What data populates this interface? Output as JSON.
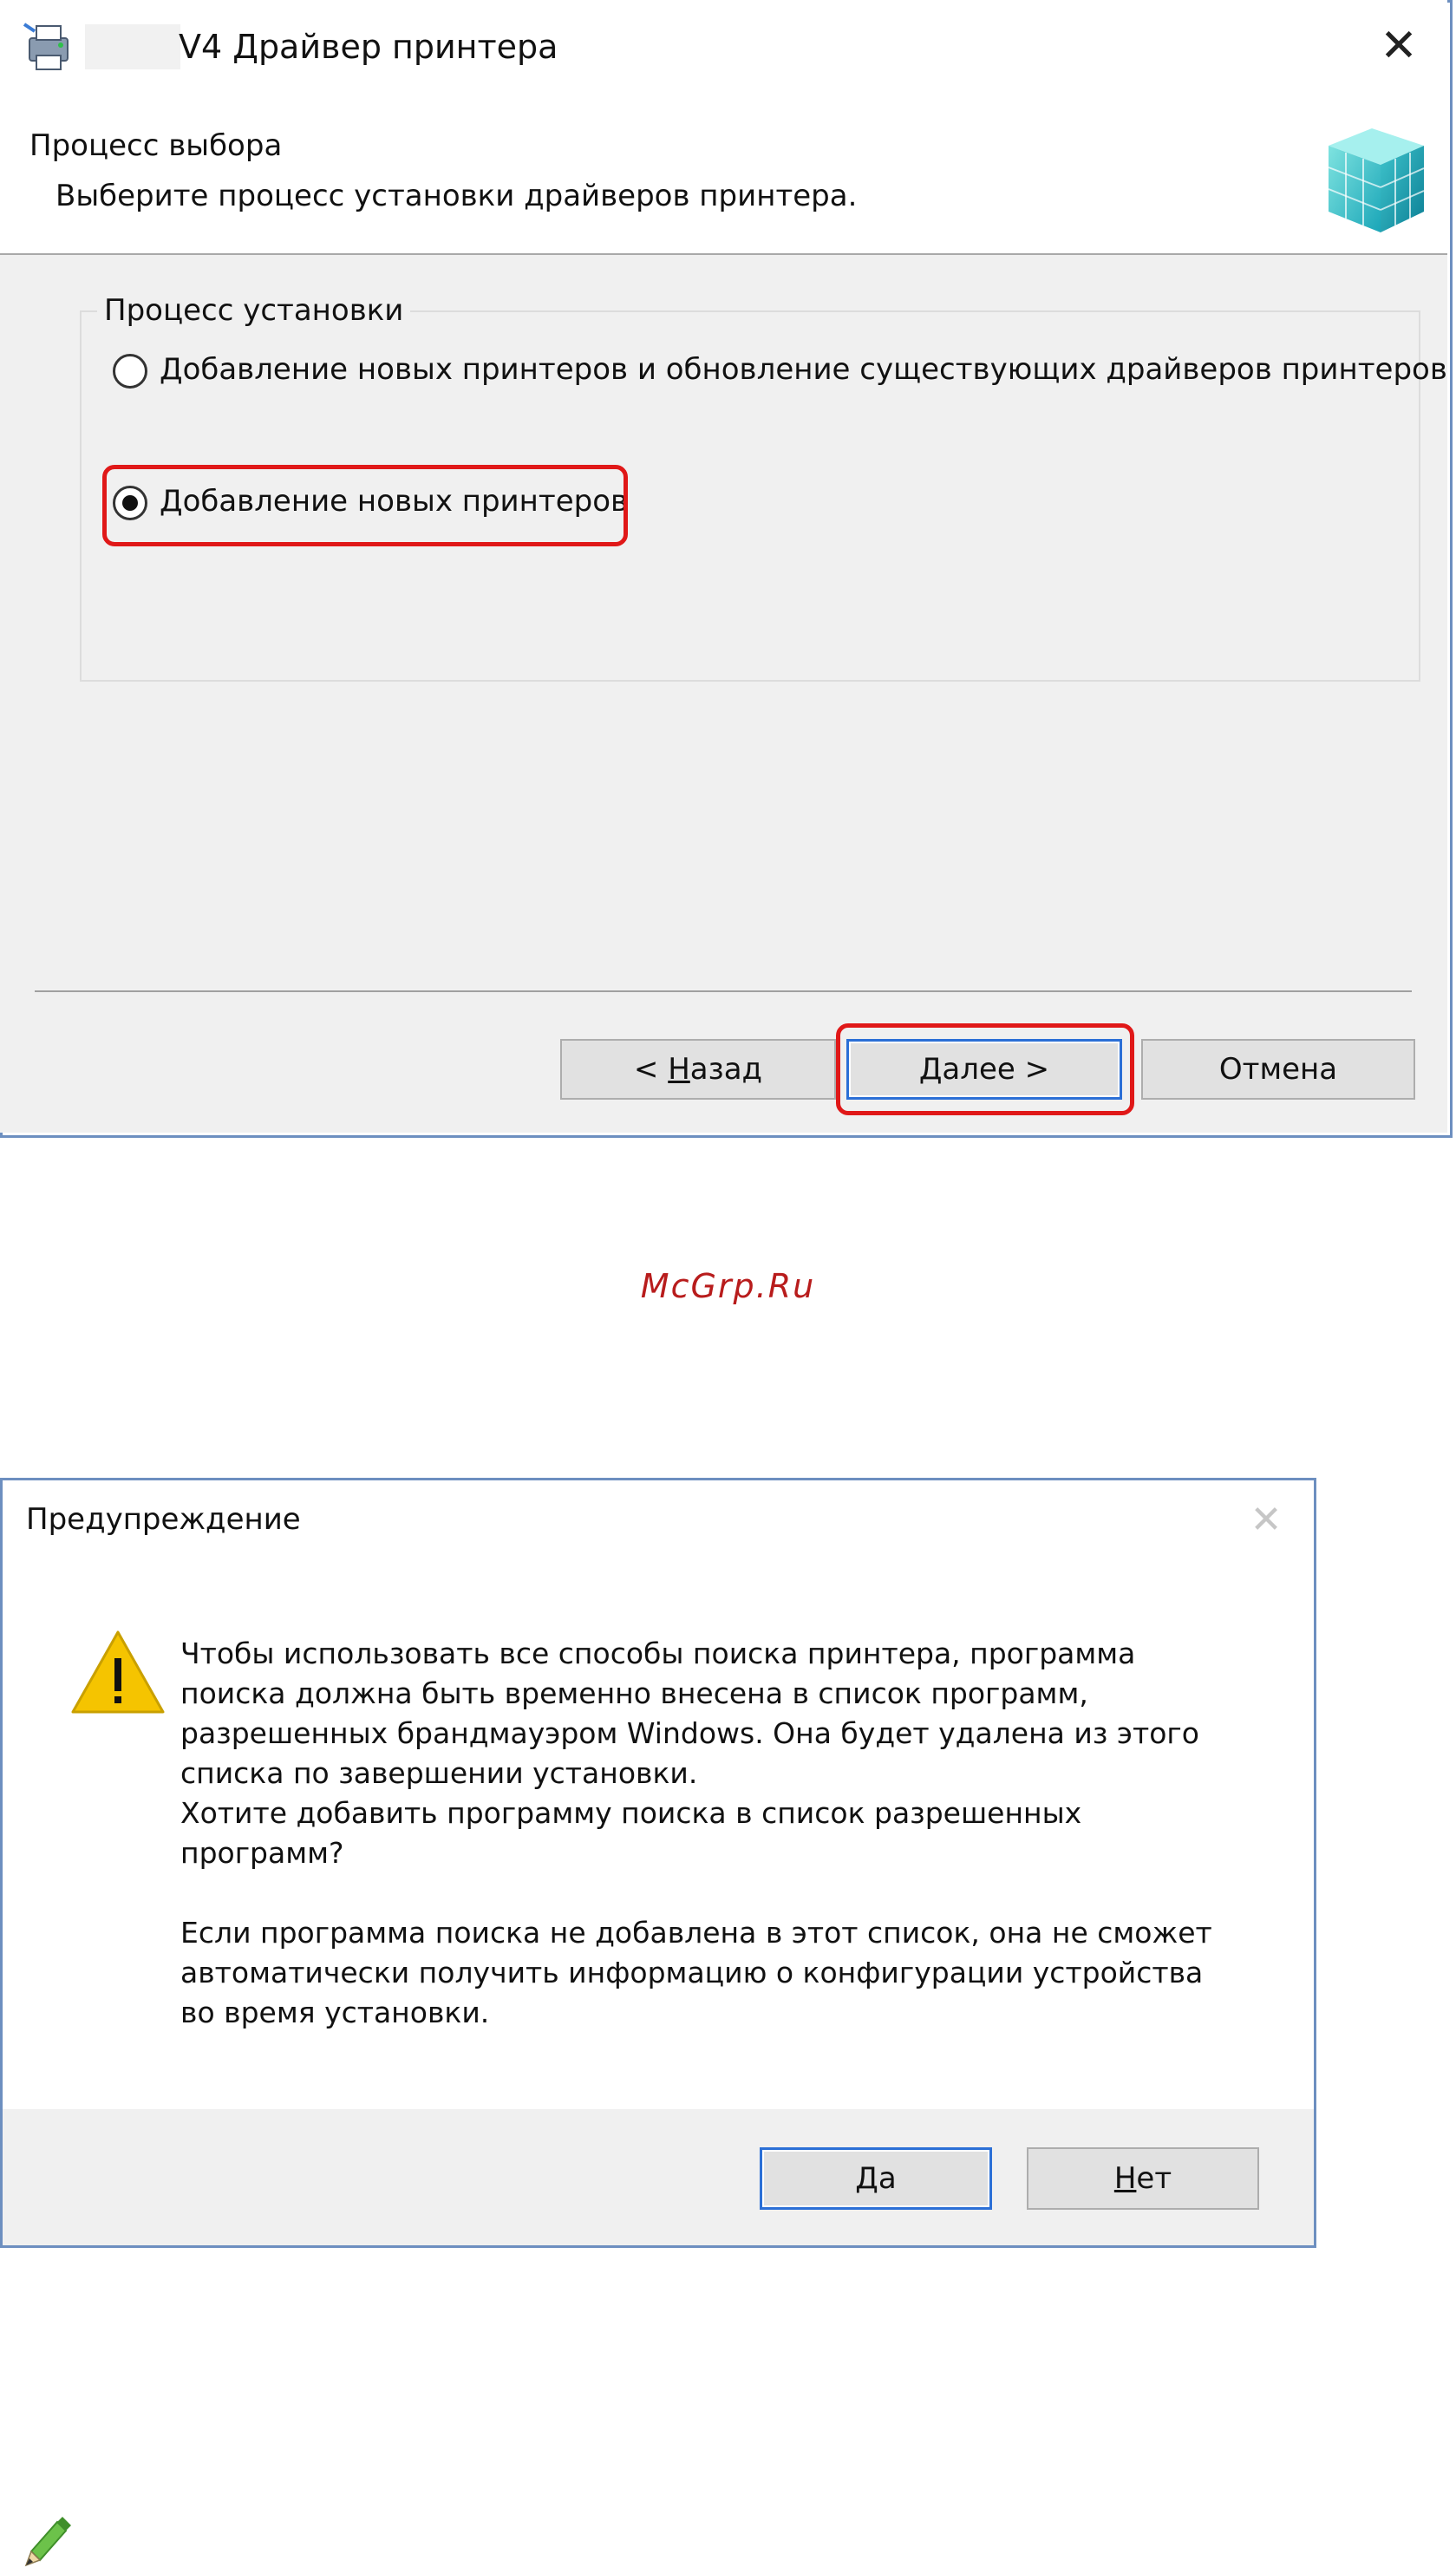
{
  "dialog1": {
    "title": "V4 Драйвер принтера",
    "header_title": "Процесс выбора",
    "header_subtitle": "Выберите процесс установки драйверов принтера.",
    "group_label": "Процесс установки",
    "options": [
      {
        "label": "Добавление новых принтеров и обновление существующих драйверов принтеров",
        "selected": false
      },
      {
        "label": "Добавление новых принтеров",
        "selected": true
      }
    ],
    "buttons": {
      "back_prefix": "< ",
      "back_mnemonic": "Н",
      "back_rest": "азад",
      "next_mnemonic": "Д",
      "next_rest": "алее >",
      "cancel": "Отмена"
    }
  },
  "watermark": "McGrp.Ru",
  "dialog2": {
    "title": "Предупреждение",
    "message": "Чтобы использовать все способы поиска принтера, программа\nпоиска должна быть временно внесена в список программ,\nразрешенных брандмауэром Windows. Она будет удалена из этого\nсписка по завершении установки.\nХотите добавить программу поиска в список разрешенных\nпрограмм?\n\nЕсли программа поиска не добавлена в этот список, она не сможет\nавтоматически получить информацию о конфигурации устройства\nво время установки.",
    "buttons": {
      "yes_mnemonic": "Д",
      "yes_rest": "а",
      "no_mnemonic": "Н",
      "no_rest": "ет"
    }
  },
  "colors": {
    "highlight": "#e01818",
    "focus_border": "#2b6fd6",
    "window_border": "#6d8fc0",
    "warning_yellow": "#f5c400"
  }
}
